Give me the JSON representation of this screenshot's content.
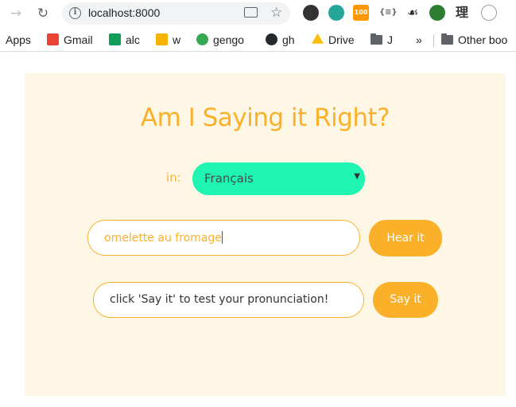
{
  "browser": {
    "url": "localhost:8000",
    "bookmarks": [
      {
        "label": "Apps",
        "icon": "apps-grid-icon",
        "color": "#4285f4"
      },
      {
        "label": "Gmail",
        "icon": "gmail-icon",
        "color": "#ea4335"
      },
      {
        "label": "alc",
        "icon": "alc-icon",
        "color": "#0f9d58"
      },
      {
        "label": "w",
        "icon": "w-icon",
        "color": "#f4b400"
      },
      {
        "label": "gengo",
        "icon": "gengo-icon",
        "color": "#34a853"
      },
      {
        "label": "gh",
        "icon": "github-icon",
        "color": "#24292e"
      },
      {
        "label": "Drive",
        "icon": "drive-icon",
        "color": "#fbbc04"
      },
      {
        "label": "J",
        "icon": "folder-icon",
        "color": "#5f6368"
      },
      {
        "label": "»",
        "icon": "chevron-more-icon",
        "color": "#5f6368"
      },
      {
        "label": "Other boo",
        "icon": "folder-icon",
        "color": "#5f6368"
      }
    ],
    "extensions": [
      {
        "icon": "mask-extension-icon",
        "color": "#333333",
        "text": ""
      },
      {
        "icon": "compass-extension-icon",
        "color": "#26a69a",
        "text": ""
      },
      {
        "icon": "rss-extension-icon",
        "color": "#ff9800",
        "text": "100"
      },
      {
        "icon": "json-extension-icon",
        "color": "#5f6368",
        "text": "{≡}"
      },
      {
        "icon": "gnome-extension-icon",
        "color": "#333333",
        "text": ""
      },
      {
        "icon": "circle-extension-icon",
        "color": "#2e7d32",
        "text": ""
      },
      {
        "icon": "kanji-extension-icon",
        "color": "#333333",
        "text": "理"
      },
      {
        "icon": "gear-extension-icon",
        "color": "#9e9e9e",
        "text": ""
      }
    ]
  },
  "app": {
    "title": "Am I Saying it Right?",
    "language_label": "in:",
    "language_selected": "Français",
    "phrase_value": "omelette au fromage",
    "hear_button": "Hear it",
    "status_text": "click 'Say it' to test your pronunciation!",
    "say_button": "Say it"
  },
  "colors": {
    "accent": "#fbb02a",
    "select_bg": "#1df5b0",
    "card_bg": "#fff7e5"
  }
}
